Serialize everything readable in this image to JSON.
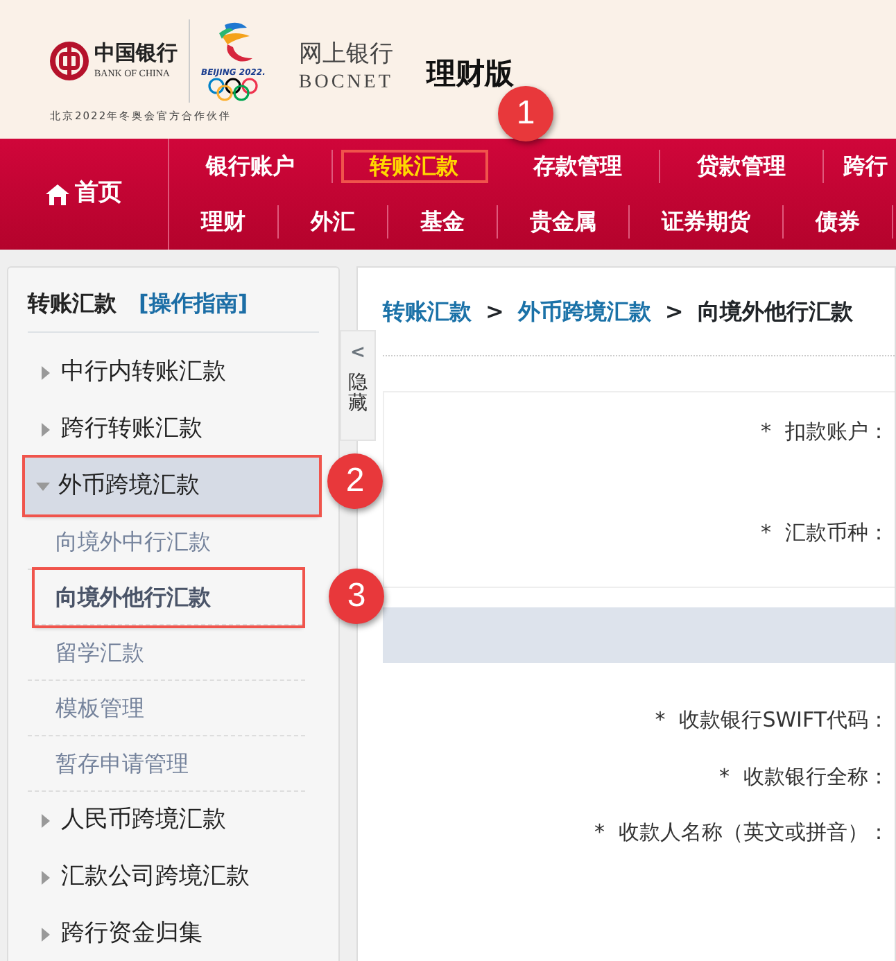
{
  "header": {
    "bank_name": "中国银行",
    "bank_name_en": "BANK OF CHINA",
    "games_mark": "BEIJING 2022.",
    "partner_line": "北京2022年冬奥会官方合作伙伴",
    "service_name": "网上银行",
    "service_name_en": "BOCNET",
    "edition": "理财版"
  },
  "nav": {
    "home": {
      "label": "首页"
    },
    "top_items": [
      {
        "label": "银行账户",
        "selected": false
      },
      {
        "label": "转账汇款",
        "selected": true,
        "highlighted": true,
        "callout": "1"
      },
      {
        "label": "存款管理",
        "selected": false
      },
      {
        "label": "贷款管理",
        "selected": false
      },
      {
        "label": "跨行",
        "selected": false
      }
    ],
    "bottom_items": [
      {
        "label": "理财",
        "selected": false
      },
      {
        "label": "外汇",
        "selected": false
      },
      {
        "label": "基金",
        "selected": false
      },
      {
        "label": "贵金属",
        "selected": false
      },
      {
        "label": "证券期货",
        "selected": false
      },
      {
        "label": "债券",
        "selected": false
      }
    ]
  },
  "sidebar": {
    "title": "转账汇款",
    "guide_link": "[操作指南]",
    "hide_toggle": {
      "arrow": "<",
      "label": "隐藏"
    },
    "items": [
      {
        "label": "中行内转账汇款",
        "expanded": false
      },
      {
        "label": "跨行转账汇款",
        "expanded": false
      },
      {
        "label": "外币跨境汇款",
        "expanded": true,
        "highlighted": true,
        "callout": "2",
        "children": [
          {
            "label": "向境外中行汇款",
            "selected": false
          },
          {
            "label": "向境外他行汇款",
            "selected": true,
            "highlighted": true,
            "callout": "3"
          },
          {
            "label": "留学汇款",
            "selected": false
          },
          {
            "label": "模板管理",
            "selected": false
          },
          {
            "label": "暂存申请管理",
            "selected": false
          }
        ]
      },
      {
        "label": "人民币跨境汇款",
        "expanded": false
      },
      {
        "label": "汇款公司跨境汇款",
        "expanded": false
      },
      {
        "label": "跨行资金归集",
        "expanded": false
      }
    ]
  },
  "breadcrumb": [
    {
      "label": "转账汇款",
      "kind": "link"
    },
    {
      "label": ">",
      "kind": "separator"
    },
    {
      "label": "外币跨境汇款",
      "kind": "link"
    },
    {
      "label": ">",
      "kind": "separator"
    },
    {
      "label": "向境外他行汇款",
      "kind": "current"
    }
  ],
  "form": {
    "payment_section": [
      {
        "required": "*",
        "label": "扣款账户："
      },
      {
        "required": "*",
        "label": "汇款币种："
      }
    ],
    "payee_section": [
      {
        "required": "*",
        "label": "收款银行SWIFT代码："
      },
      {
        "required": "*",
        "label": "收款银行全称："
      },
      {
        "required": "*",
        "label": "收款人名称（英文或拼音）："
      }
    ]
  }
}
